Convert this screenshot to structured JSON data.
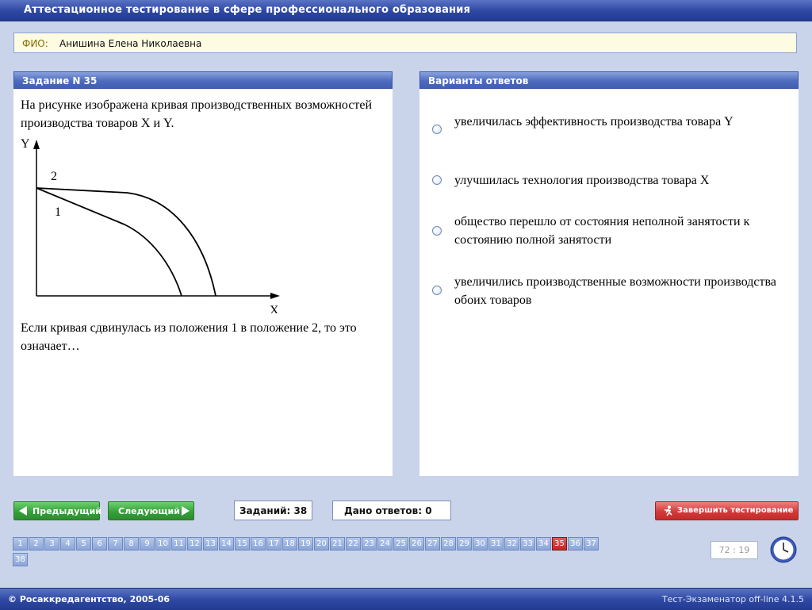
{
  "app": {
    "title": "Аттестационное тестирование в сфере профессионального образования"
  },
  "student": {
    "label": "ФИО:",
    "name": "Анишина Елена Николаевна"
  },
  "task": {
    "header": "Задание N 35",
    "text_top": "На рисунке изображена кривая производственных возможностей производства товаров X и Y.",
    "text_bottom": "Если кривая сдвинулась из положения 1 в положение 2, то это означает…",
    "figure": {
      "y_label": "Y",
      "x_label": "X",
      "curve1_label": "1",
      "curve2_label": "2"
    }
  },
  "answers": {
    "header": "Варианты ответов",
    "options": [
      {
        "text": "увеличилась эффективность производства товара Y",
        "selected": false
      },
      {
        "text": "улучшилась технология производства товара X",
        "selected": false
      },
      {
        "text": "общество перешло от состояния неполной занятости к состоянию полной занятости",
        "selected": false
      },
      {
        "text": "увеличились производственные возможности производства обоих товаров",
        "selected": false
      }
    ]
  },
  "nav": {
    "prev_label": "Предыдущий",
    "next_label": "Следующий",
    "finish_label": "Завершить тестирование",
    "tasks_label": "Заданий: 38",
    "answered_label": "Дано ответов: 0",
    "current": 35,
    "numbers": [
      "1",
      "2",
      "3",
      "4",
      "5",
      "6",
      "7",
      "8",
      "9",
      "10",
      "11",
      "12",
      "13",
      "14",
      "15",
      "16",
      "17",
      "18",
      "19",
      "20",
      "21",
      "22",
      "23",
      "24",
      "25",
      "26",
      "27",
      "28",
      "29",
      "30",
      "31",
      "32",
      "33",
      "34",
      "35",
      "36",
      "37",
      "38"
    ]
  },
  "timer": {
    "value": "72 : 19"
  },
  "footer": {
    "copyright": "© Росаккредагентство, 2005-06",
    "version": "Тест-Экзаменатор off-line 4.1.5"
  },
  "colors": {
    "accent": "#2d47a3",
    "active_question": "#c32424",
    "background": "#c9d4ea"
  }
}
